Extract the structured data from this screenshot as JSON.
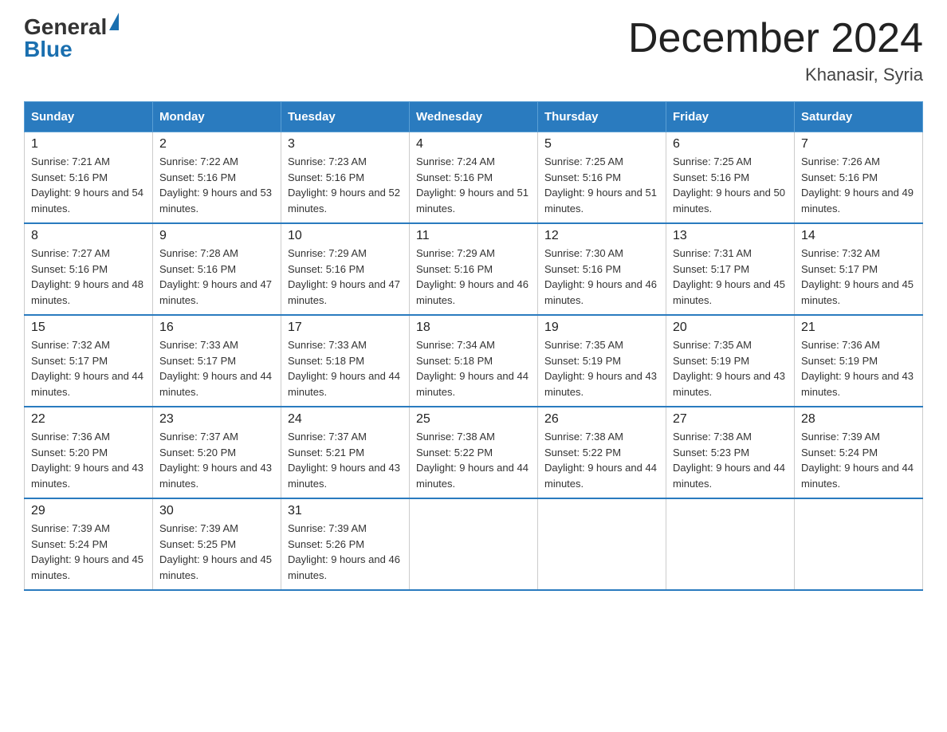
{
  "header": {
    "logo_general": "General",
    "logo_blue": "Blue",
    "month_year": "December 2024",
    "location": "Khanasir, Syria"
  },
  "weekdays": [
    "Sunday",
    "Monday",
    "Tuesday",
    "Wednesday",
    "Thursday",
    "Friday",
    "Saturday"
  ],
  "weeks": [
    [
      {
        "day": "1",
        "sunrise": "7:21 AM",
        "sunset": "5:16 PM",
        "daylight": "9 hours and 54 minutes."
      },
      {
        "day": "2",
        "sunrise": "7:22 AM",
        "sunset": "5:16 PM",
        "daylight": "9 hours and 53 minutes."
      },
      {
        "day": "3",
        "sunrise": "7:23 AM",
        "sunset": "5:16 PM",
        "daylight": "9 hours and 52 minutes."
      },
      {
        "day": "4",
        "sunrise": "7:24 AM",
        "sunset": "5:16 PM",
        "daylight": "9 hours and 51 minutes."
      },
      {
        "day": "5",
        "sunrise": "7:25 AM",
        "sunset": "5:16 PM",
        "daylight": "9 hours and 51 minutes."
      },
      {
        "day": "6",
        "sunrise": "7:25 AM",
        "sunset": "5:16 PM",
        "daylight": "9 hours and 50 minutes."
      },
      {
        "day": "7",
        "sunrise": "7:26 AM",
        "sunset": "5:16 PM",
        "daylight": "9 hours and 49 minutes."
      }
    ],
    [
      {
        "day": "8",
        "sunrise": "7:27 AM",
        "sunset": "5:16 PM",
        "daylight": "9 hours and 48 minutes."
      },
      {
        "day": "9",
        "sunrise": "7:28 AM",
        "sunset": "5:16 PM",
        "daylight": "9 hours and 47 minutes."
      },
      {
        "day": "10",
        "sunrise": "7:29 AM",
        "sunset": "5:16 PM",
        "daylight": "9 hours and 47 minutes."
      },
      {
        "day": "11",
        "sunrise": "7:29 AM",
        "sunset": "5:16 PM",
        "daylight": "9 hours and 46 minutes."
      },
      {
        "day": "12",
        "sunrise": "7:30 AM",
        "sunset": "5:16 PM",
        "daylight": "9 hours and 46 minutes."
      },
      {
        "day": "13",
        "sunrise": "7:31 AM",
        "sunset": "5:17 PM",
        "daylight": "9 hours and 45 minutes."
      },
      {
        "day": "14",
        "sunrise": "7:32 AM",
        "sunset": "5:17 PM",
        "daylight": "9 hours and 45 minutes."
      }
    ],
    [
      {
        "day": "15",
        "sunrise": "7:32 AM",
        "sunset": "5:17 PM",
        "daylight": "9 hours and 44 minutes."
      },
      {
        "day": "16",
        "sunrise": "7:33 AM",
        "sunset": "5:17 PM",
        "daylight": "9 hours and 44 minutes."
      },
      {
        "day": "17",
        "sunrise": "7:33 AM",
        "sunset": "5:18 PM",
        "daylight": "9 hours and 44 minutes."
      },
      {
        "day": "18",
        "sunrise": "7:34 AM",
        "sunset": "5:18 PM",
        "daylight": "9 hours and 44 minutes."
      },
      {
        "day": "19",
        "sunrise": "7:35 AM",
        "sunset": "5:19 PM",
        "daylight": "9 hours and 43 minutes."
      },
      {
        "day": "20",
        "sunrise": "7:35 AM",
        "sunset": "5:19 PM",
        "daylight": "9 hours and 43 minutes."
      },
      {
        "day": "21",
        "sunrise": "7:36 AM",
        "sunset": "5:19 PM",
        "daylight": "9 hours and 43 minutes."
      }
    ],
    [
      {
        "day": "22",
        "sunrise": "7:36 AM",
        "sunset": "5:20 PM",
        "daylight": "9 hours and 43 minutes."
      },
      {
        "day": "23",
        "sunrise": "7:37 AM",
        "sunset": "5:20 PM",
        "daylight": "9 hours and 43 minutes."
      },
      {
        "day": "24",
        "sunrise": "7:37 AM",
        "sunset": "5:21 PM",
        "daylight": "9 hours and 43 minutes."
      },
      {
        "day": "25",
        "sunrise": "7:38 AM",
        "sunset": "5:22 PM",
        "daylight": "9 hours and 44 minutes."
      },
      {
        "day": "26",
        "sunrise": "7:38 AM",
        "sunset": "5:22 PM",
        "daylight": "9 hours and 44 minutes."
      },
      {
        "day": "27",
        "sunrise": "7:38 AM",
        "sunset": "5:23 PM",
        "daylight": "9 hours and 44 minutes."
      },
      {
        "day": "28",
        "sunrise": "7:39 AM",
        "sunset": "5:24 PM",
        "daylight": "9 hours and 44 minutes."
      }
    ],
    [
      {
        "day": "29",
        "sunrise": "7:39 AM",
        "sunset": "5:24 PM",
        "daylight": "9 hours and 45 minutes."
      },
      {
        "day": "30",
        "sunrise": "7:39 AM",
        "sunset": "5:25 PM",
        "daylight": "9 hours and 45 minutes."
      },
      {
        "day": "31",
        "sunrise": "7:39 AM",
        "sunset": "5:26 PM",
        "daylight": "9 hours and 46 minutes."
      },
      null,
      null,
      null,
      null
    ]
  ]
}
